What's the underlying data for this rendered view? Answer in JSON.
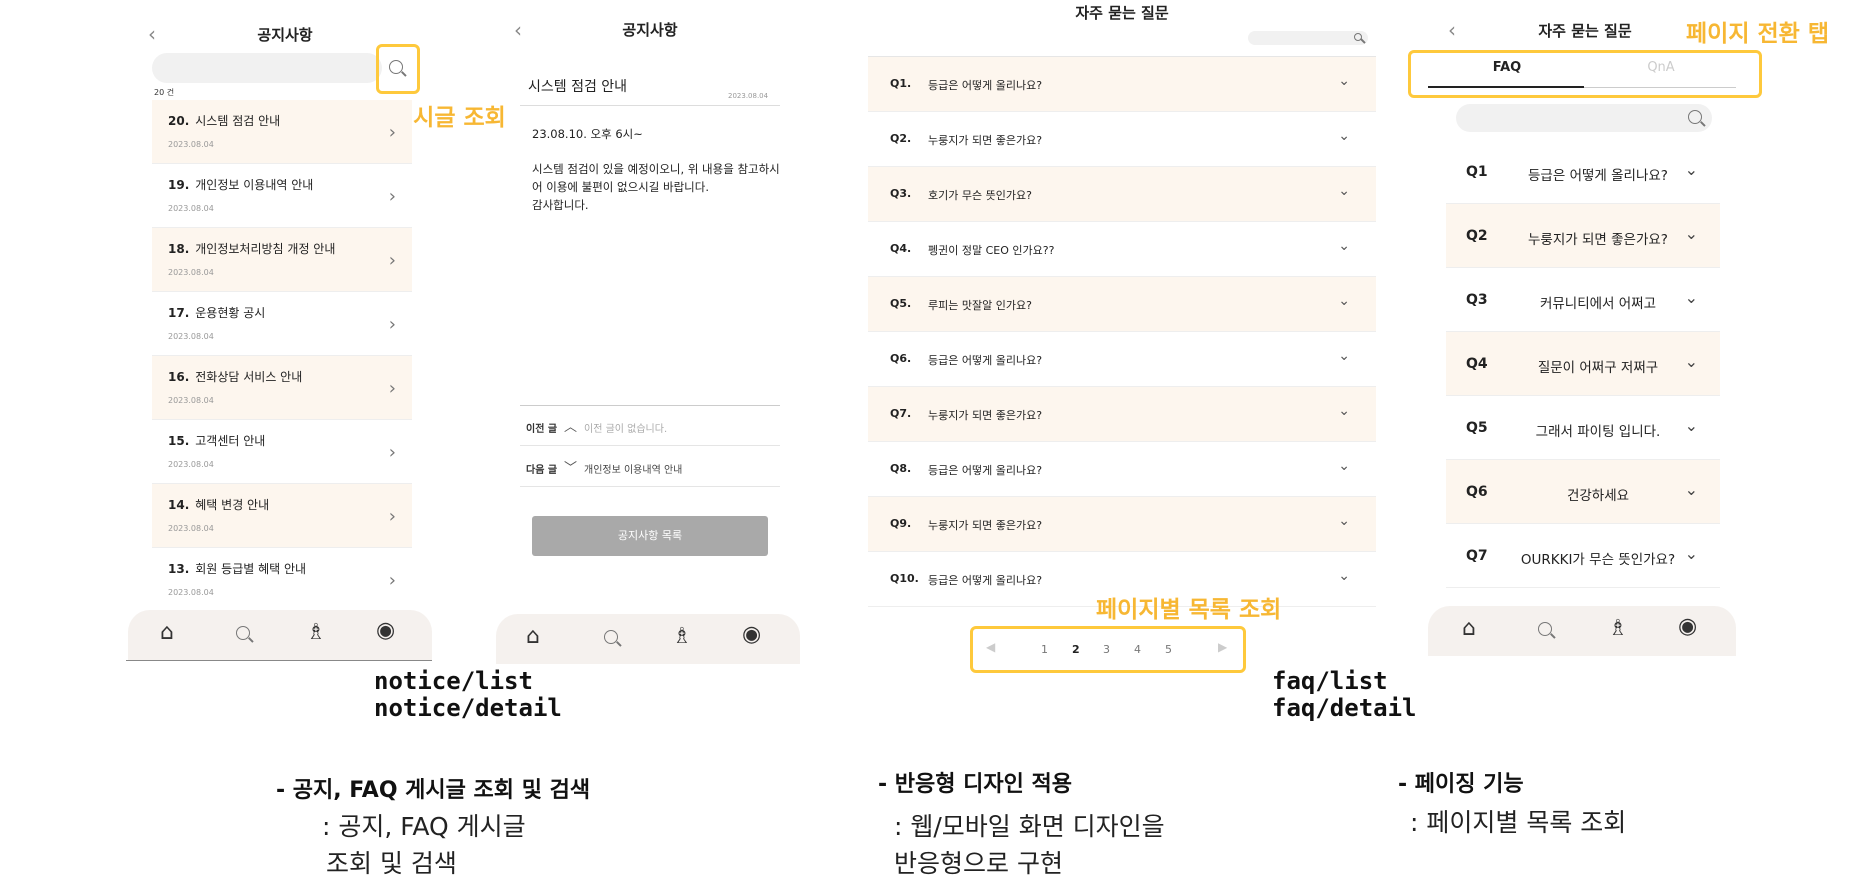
{
  "screens": {
    "notice_list": {
      "title": "공지사항",
      "count": "20 건",
      "items": [
        {
          "num": "20.",
          "title": "시스템 점검 안내",
          "date": "2023.08.04"
        },
        {
          "num": "19.",
          "title": "개인정보 이용내역 안내",
          "date": "2023.08.04"
        },
        {
          "num": "18.",
          "title": "개인정보처리방침 개정 안내",
          "date": "2023.08.04"
        },
        {
          "num": "17.",
          "title": "운용현황 공시",
          "date": "2023.08.04"
        },
        {
          "num": "16.",
          "title": "전화상담 서비스 안내",
          "date": "2023.08.04"
        },
        {
          "num": "15.",
          "title": "고객센터 안내",
          "date": "2023.08.04"
        },
        {
          "num": "14.",
          "title": "혜택 변경 안내",
          "date": "2023.08.04"
        },
        {
          "num": "13.",
          "title": "회원 등급별 혜택 안내",
          "date": "2023.08.04"
        }
      ],
      "search_annotation": "게시글 조회"
    },
    "notice_detail": {
      "title": "공지사항",
      "article_title": "시스템 점검 안내",
      "date": "2023.08.04",
      "body_line1": "23.08.10. 오후 6시~",
      "body": "시스템 점검이 있을 예정이오니, 위 내용을 참고하시\n어 이용에 불편이 없으시길 바랍니다.\n감사합니다.",
      "prev_label": "이전 글",
      "prev_text": "이전 글이 없습니다.",
      "next_label": "다음 글",
      "next_text": "개인정보 이용내역 안내",
      "list_button": "공지사항 목록"
    },
    "faq_list": {
      "title": "자주 묻는 질문",
      "items": [
        {
          "num": "Q1.",
          "q": "등급은 어떻게 올리나요?"
        },
        {
          "num": "Q2.",
          "q": "누룽지가 되면 좋은가요?"
        },
        {
          "num": "Q3.",
          "q": "호기가 무슨 뜻인가요?"
        },
        {
          "num": "Q4.",
          "q": "펭귄이 정말 CEO 인가요??"
        },
        {
          "num": "Q5.",
          "q": "루피는 맛잘알 인가요?"
        },
        {
          "num": "Q6.",
          "q": "등급은 어떻게 올리나요?"
        },
        {
          "num": "Q7.",
          "q": "누룽지가 되면 좋은가요?"
        },
        {
          "num": "Q8.",
          "q": "등급은 어떻게 올리나요?"
        },
        {
          "num": "Q9.",
          "q": "누룽지가 되면 좋은가요?"
        },
        {
          "num": "Q10.",
          "q": "등급은 어떻게 올리나요?"
        }
      ],
      "pages": [
        "1",
        "2",
        "3",
        "4",
        "5"
      ],
      "current_page": "2",
      "pagination_annotation": "페이지별 목록 조회"
    },
    "faq_detail": {
      "title": "자주 묻는 질문",
      "tabs": [
        "FAQ",
        "QnA"
      ],
      "active_tab": "FAQ",
      "tab_annotation": "페이지 전환 탭",
      "items": [
        {
          "num": "Q1",
          "q": "등급은 어떻게 올리나요?"
        },
        {
          "num": "Q2",
          "q": "누룽지가 되면 좋은가요?"
        },
        {
          "num": "Q3",
          "q": "커뮤니티에서 어쩌고"
        },
        {
          "num": "Q4",
          "q": "질문이 어쩌구 저쩌구"
        },
        {
          "num": "Q5",
          "q": "그래서 파이팅 입니다."
        },
        {
          "num": "Q6",
          "q": "건강하세요"
        },
        {
          "num": "Q7",
          "q": "OURKKI가 무슨 뜻인가요?"
        }
      ]
    }
  },
  "tabbar_icons": [
    "home-icon",
    "search-icon",
    "community-icon",
    "profile-icon"
  ],
  "routes": {
    "notice_list": "notice/list",
    "notice_detail": "notice/detail",
    "faq_list": "faq/list",
    "faq_detail": "faq/detail"
  },
  "descriptions": [
    {
      "title": "- 공지, FAQ 게시글 조회 및 검색",
      "line1": ": 공지, FAQ 게시글",
      "line2": "조회 및 검색"
    },
    {
      "title": "- 반응형 디자인 적용",
      "line1": ": 웹/모바일 화면 디자인을",
      "line2": "반응형으로 구현"
    },
    {
      "title": "- 페이징 기능",
      "line1": ": 페이지별 목록 조회"
    }
  ],
  "colors": {
    "accent": "#fec93c",
    "annotation": "#f7b733",
    "row_alt": "#fdf6ee"
  }
}
